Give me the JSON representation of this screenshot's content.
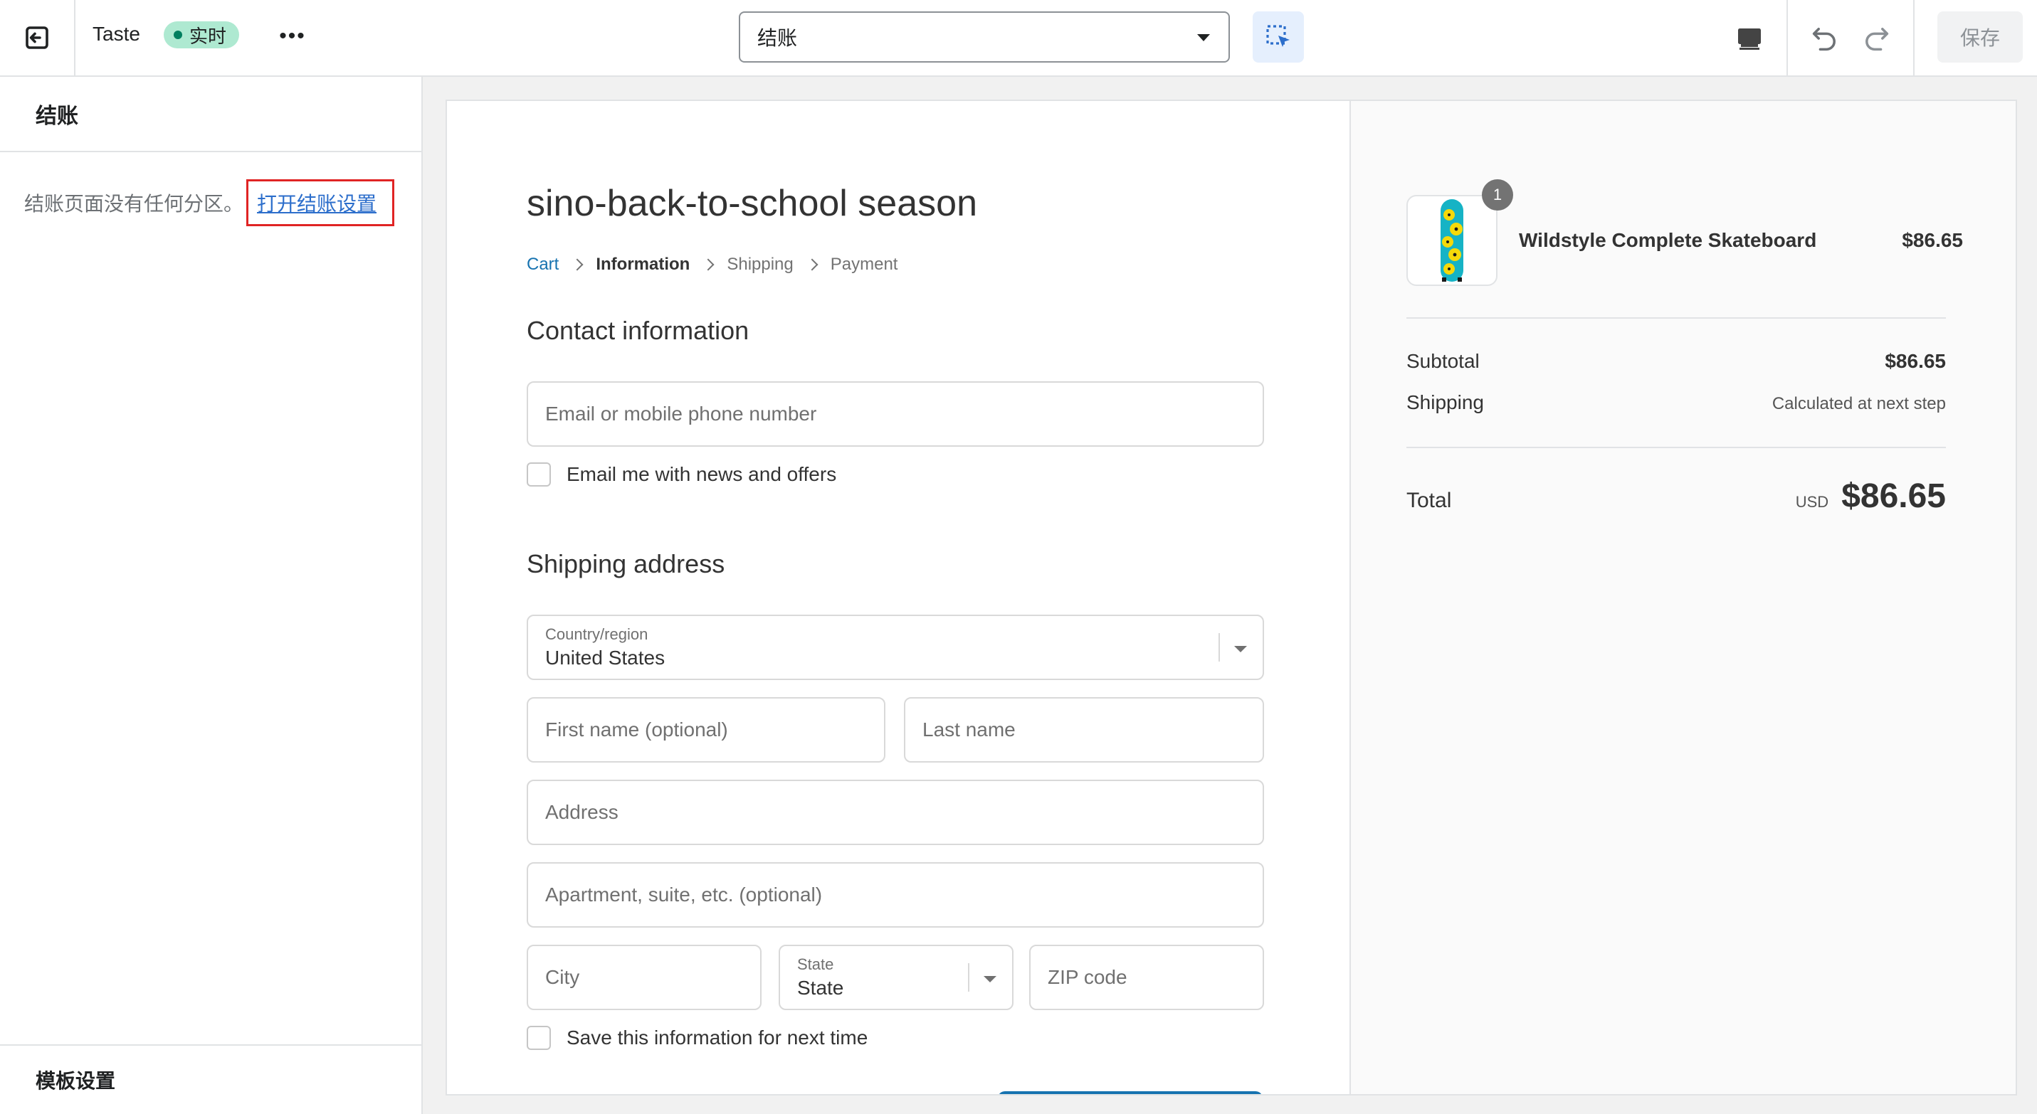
{
  "topbar": {
    "theme_name": "Taste",
    "live_badge": "实时",
    "more": "•••",
    "page_select": "结账",
    "save_label": "保存"
  },
  "sidebar": {
    "title": "结账",
    "note": "结账页面没有任何分区。",
    "link": "打开结账设置",
    "footer": "模板设置"
  },
  "checkout": {
    "shop_name": "sino-back-to-school season",
    "breadcrumb": [
      "Cart",
      "Information",
      "Shipping",
      "Payment"
    ],
    "contact_heading": "Contact information",
    "email_placeholder": "Email or mobile phone number",
    "news_label": "Email me with news and offers",
    "shipping_heading": "Shipping address",
    "country_label": "Country/region",
    "country_value": "United States",
    "first_name": "First name (optional)",
    "last_name": "Last name",
    "address": "Address",
    "apartment": "Apartment, suite, etc. (optional)",
    "city": "City",
    "state_label": "State",
    "state_value": "State",
    "zip": "ZIP code",
    "save_info_label": "Save this information for next time"
  },
  "summary": {
    "product_name": "Wildstyle Complete Skateboard",
    "product_price": "$86.65",
    "quantity": "1",
    "subtotal_label": "Subtotal",
    "subtotal_value": "$86.65",
    "shipping_label": "Shipping",
    "shipping_value": "Calculated at next step",
    "total_label": "Total",
    "currency": "USD",
    "total_value": "$86.65"
  },
  "colors": {
    "accent_link": "#2c6ecb",
    "checkout_blue": "#1773b0",
    "live_badge_bg": "#aee9d1",
    "highlight_border": "#e02424"
  }
}
